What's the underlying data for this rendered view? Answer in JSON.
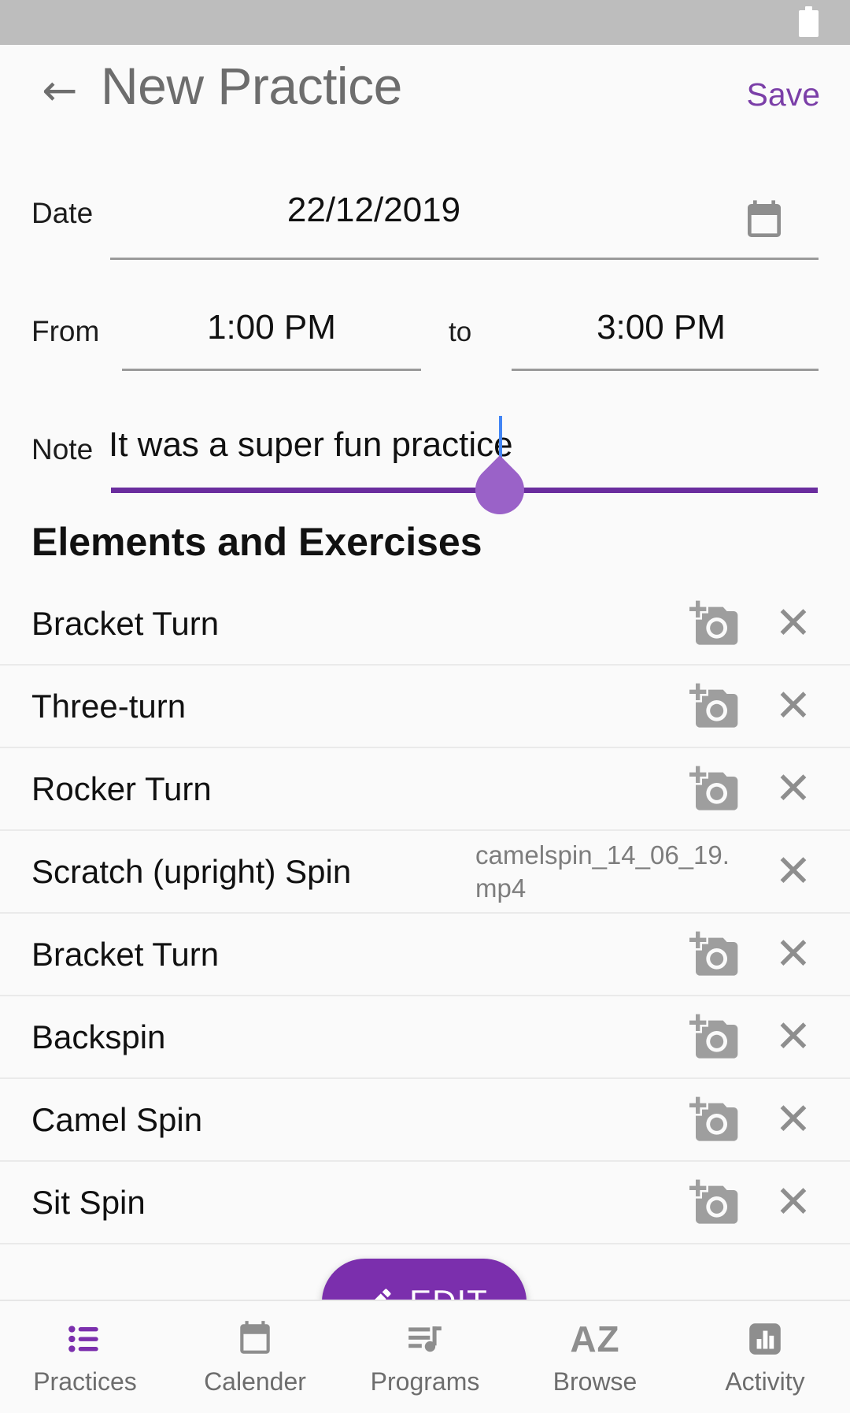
{
  "statusbar": {
    "battery_icon": "battery-icon"
  },
  "appbar": {
    "back_icon": "back-arrow-icon",
    "title": "New Practice",
    "save_label": "Save",
    "save_color": "#7b3fa8"
  },
  "form": {
    "date": {
      "label": "Date",
      "value": "22/12/2019",
      "icon": "calendar-icon"
    },
    "time": {
      "from_label": "From",
      "from_value": "1:00 PM",
      "to_label": "to",
      "to_value": "3:00 PM"
    },
    "note": {
      "label": "Note",
      "value": "It was a super fun practice",
      "caret_color": "#4285f4",
      "underline_color": "#6a2d9e",
      "handle_color": "#9a62c8"
    }
  },
  "section": {
    "title": "Elements and Exercises"
  },
  "elements": [
    {
      "name": "Bracket Turn",
      "media": "",
      "action_icon": "add-a-photo-icon",
      "remove_icon": "close-icon"
    },
    {
      "name": "Three-turn",
      "media": "",
      "action_icon": "add-a-photo-icon",
      "remove_icon": "close-icon"
    },
    {
      "name": "Rocker Turn",
      "media": "",
      "action_icon": "add-a-photo-icon",
      "remove_icon": "close-icon"
    },
    {
      "name": "Scratch (upright) Spin",
      "media": "camelspin_14_06_19.mp4",
      "action_icon": "",
      "remove_icon": "close-icon"
    },
    {
      "name": "Bracket Turn",
      "media": "",
      "action_icon": "add-a-photo-icon",
      "remove_icon": "close-icon"
    },
    {
      "name": "Backspin",
      "media": "",
      "action_icon": "add-a-photo-icon",
      "remove_icon": "close-icon"
    },
    {
      "name": "Camel Spin",
      "media": "",
      "action_icon": "add-a-photo-icon",
      "remove_icon": "close-icon"
    },
    {
      "name": "Sit Spin",
      "media": "",
      "action_icon": "add-a-photo-icon",
      "remove_icon": "close-icon"
    }
  ],
  "fab": {
    "label": "EDIT",
    "icon": "pencil-icon",
    "color": "#7b2fad"
  },
  "bottomnav": {
    "active_color": "#7b2fad",
    "inactive_color": "#8e8e8e",
    "items": [
      {
        "label": "Practices",
        "icon": "bulleted-list-icon",
        "active": true
      },
      {
        "label": "Calender",
        "icon": "calendar-icon",
        "active": false
      },
      {
        "label": "Programs",
        "icon": "playlist-music-icon",
        "active": false
      },
      {
        "label": "Browse",
        "icon": "az-sort-icon",
        "active": false
      },
      {
        "label": "Activity",
        "icon": "bar-chart-icon",
        "active": false
      }
    ]
  }
}
